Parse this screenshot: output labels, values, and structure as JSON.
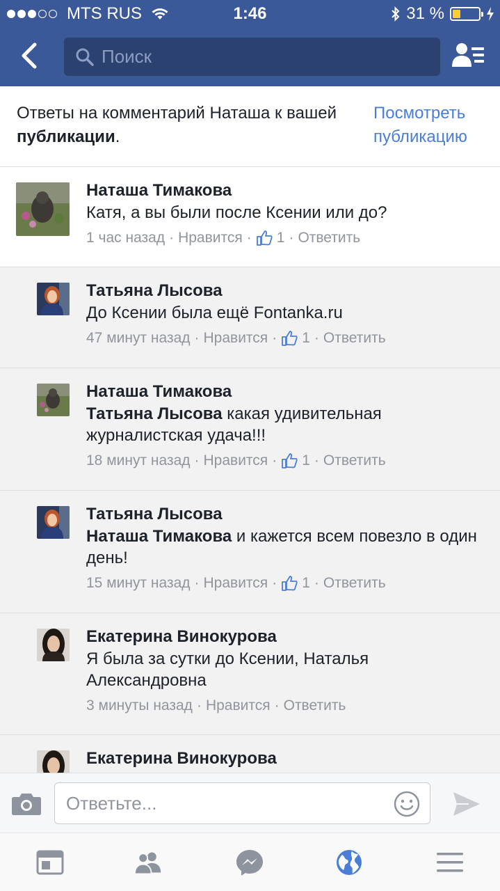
{
  "status_bar": {
    "carrier": "MTS RUS",
    "time": "1:46",
    "battery": "31 %",
    "battery_level": 0.31
  },
  "header": {
    "search_placeholder": "Поиск"
  },
  "banner": {
    "text_prefix": "Ответы на комментарий Наташа к вашей ",
    "text_bold": "публикации",
    "text_suffix": ".",
    "view_link": "Посмотреть публикацию"
  },
  "comments": [
    {
      "author": "Наташа Тимакова",
      "mention": "",
      "text": "Катя, а вы были после Ксении или до?",
      "time": "1 час назад",
      "like_label": "Нравится",
      "likes": "1",
      "reply_label": "Ответить"
    },
    {
      "author": "Татьяна Лысова",
      "mention": "",
      "text": "До Ксении была ещё Fontanka.ru",
      "time": "47 минут назад",
      "like_label": "Нравится",
      "likes": "1",
      "reply_label": "Ответить"
    },
    {
      "author": "Наташа Тимакова",
      "mention": "Татьяна Лысова",
      "text": " какая удивительная журналистская удача!!!",
      "time": "18 минут назад",
      "like_label": "Нравится",
      "likes": "1",
      "reply_label": "Ответить"
    },
    {
      "author": "Татьяна Лысова",
      "mention": "Наташа Тимакова",
      "text": " и кажется всем повезло в один день!",
      "time": "15 минут назад",
      "like_label": "Нравится",
      "likes": "1",
      "reply_label": "Ответить"
    },
    {
      "author": "Екатерина Винокурова",
      "mention": "",
      "text": "Я была за сутки до Ксении, Наталья Александровна",
      "time": "3 минуты назад",
      "like_label": "Нравится",
      "likes": "",
      "reply_label": "Ответить"
    },
    {
      "author": "Екатерина Винокурова"
    }
  ],
  "reply_bar": {
    "placeholder": "Ответьте..."
  },
  "tabs": [
    "news-feed",
    "friends",
    "messenger",
    "notifications",
    "more"
  ],
  "colors": {
    "brand": "#3b5998",
    "link": "#4a7dd6",
    "active_tab": "#4a7dd6"
  }
}
